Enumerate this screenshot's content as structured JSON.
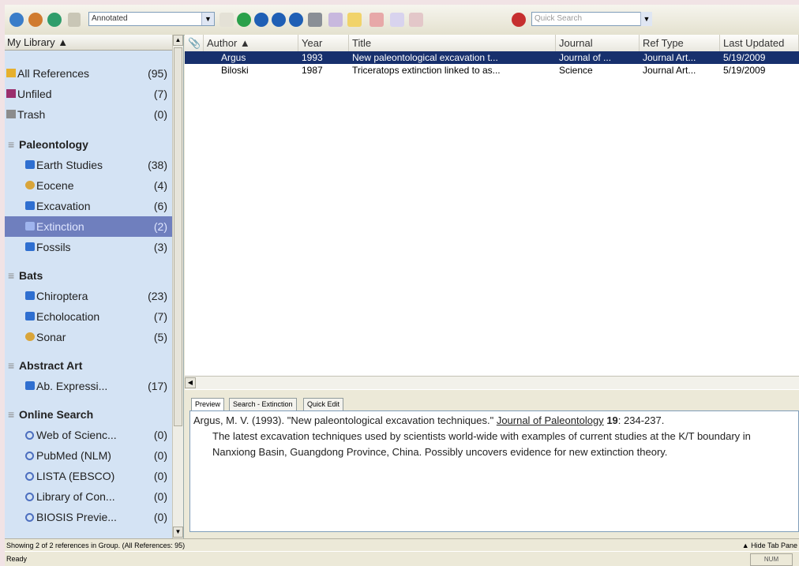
{
  "toolbar": {
    "style_value": "Annotated",
    "search_placeholder": "Quick Search",
    "icons": [
      "endnote-icon",
      "group-icon",
      "globe-icon",
      "new-reference-icon",
      "search-remote-icon",
      "find-full-text-icon",
      "open-url-icon",
      "online-search-icon",
      "pdf-icon",
      "insert-citation-icon",
      "format-bibliography-icon",
      "return-to-word-icon",
      "help-icon"
    ]
  },
  "library": {
    "header": "My Library ▲",
    "items": [
      {
        "label": "All References",
        "count": "(95)",
        "icon": "all-references-icon",
        "type": "top"
      },
      {
        "label": "Unfiled",
        "count": "(7)",
        "icon": "unfiled-icon",
        "type": "top"
      },
      {
        "label": "Trash",
        "count": "(0)",
        "icon": "trash-icon",
        "type": "top"
      }
    ],
    "groups": [
      {
        "name": "Paleontology",
        "toggle": "≡",
        "items": [
          {
            "label": "Earth Studies",
            "count": "(38)",
            "icon": "folder-icon"
          },
          {
            "label": "Eocene",
            "count": "(4)",
            "icon": "smart-group-icon"
          },
          {
            "label": "Excavation",
            "count": "(6)",
            "icon": "folder-icon"
          },
          {
            "label": "Extinction",
            "count": "(2)",
            "icon": "folder-icon",
            "selected": true
          },
          {
            "label": "Fossils",
            "count": "(3)",
            "icon": "folder-icon"
          }
        ]
      },
      {
        "name": "Bats",
        "toggle": "≡",
        "items": [
          {
            "label": "Chiroptera",
            "count": "(23)",
            "icon": "folder-icon"
          },
          {
            "label": "Echolocation",
            "count": "(7)",
            "icon": "folder-icon"
          },
          {
            "label": "Sonar",
            "count": "(5)",
            "icon": "smart-group-icon"
          }
        ]
      },
      {
        "name": "Abstract Art",
        "toggle": "≡",
        "items": [
          {
            "label": "Ab. Expressi...",
            "count": "(17)",
            "icon": "folder-icon"
          }
        ]
      },
      {
        "name": "Online Search",
        "toggle": "≡",
        "items": [
          {
            "label": "Web of Scienc...",
            "count": "(0)",
            "icon": "online-search-icon"
          },
          {
            "label": "PubMed (NLM)",
            "count": "(0)",
            "icon": "online-search-icon"
          },
          {
            "label": "LISTA (EBSCO)",
            "count": "(0)",
            "icon": "online-search-icon"
          },
          {
            "label": "Library of Con...",
            "count": "(0)",
            "icon": "online-search-icon"
          },
          {
            "label": "BIOSIS Previe...",
            "count": "(0)",
            "icon": "online-search-icon"
          }
        ]
      }
    ]
  },
  "list": {
    "columns": [
      "Author ▲",
      "Year",
      "Title",
      "Journal",
      "Ref Type",
      "Last Updated"
    ],
    "rows": [
      {
        "author": "Argus",
        "year": "1993",
        "title": "New paleontological excavation t...",
        "journal": "Journal of ...",
        "ref_type": "Journal Art...",
        "updated": "5/19/2009",
        "selected": true
      },
      {
        "author": "Biloski",
        "year": "1987",
        "title": "Triceratops extinction linked to as...",
        "journal": "Science",
        "ref_type": "Journal Art...",
        "updated": "5/19/2009",
        "selected": false
      }
    ]
  },
  "preview": {
    "tabs": [
      "Preview",
      "Search - Extinction",
      "Quick Edit"
    ],
    "citation_lead": "Argus, M. V. (1993). \"New paleontological excavation techniques.\" ",
    "journal": "Journal of Paleontology",
    "volume": "19",
    "pages": ": 234-237.",
    "abstract": "The latest excavation techniques used by scientists world-wide with examples of current studies at the K/T boundary in Nanxiong Basin, Guangdong Province, China. Possibly uncovers evidence for new extinction theory."
  },
  "status": {
    "line1": "Showing 2 of 2 references in Group. (All References: 95)",
    "hide_tab": "Hide Tab Pane",
    "line2": "Ready",
    "num": "NUM"
  }
}
